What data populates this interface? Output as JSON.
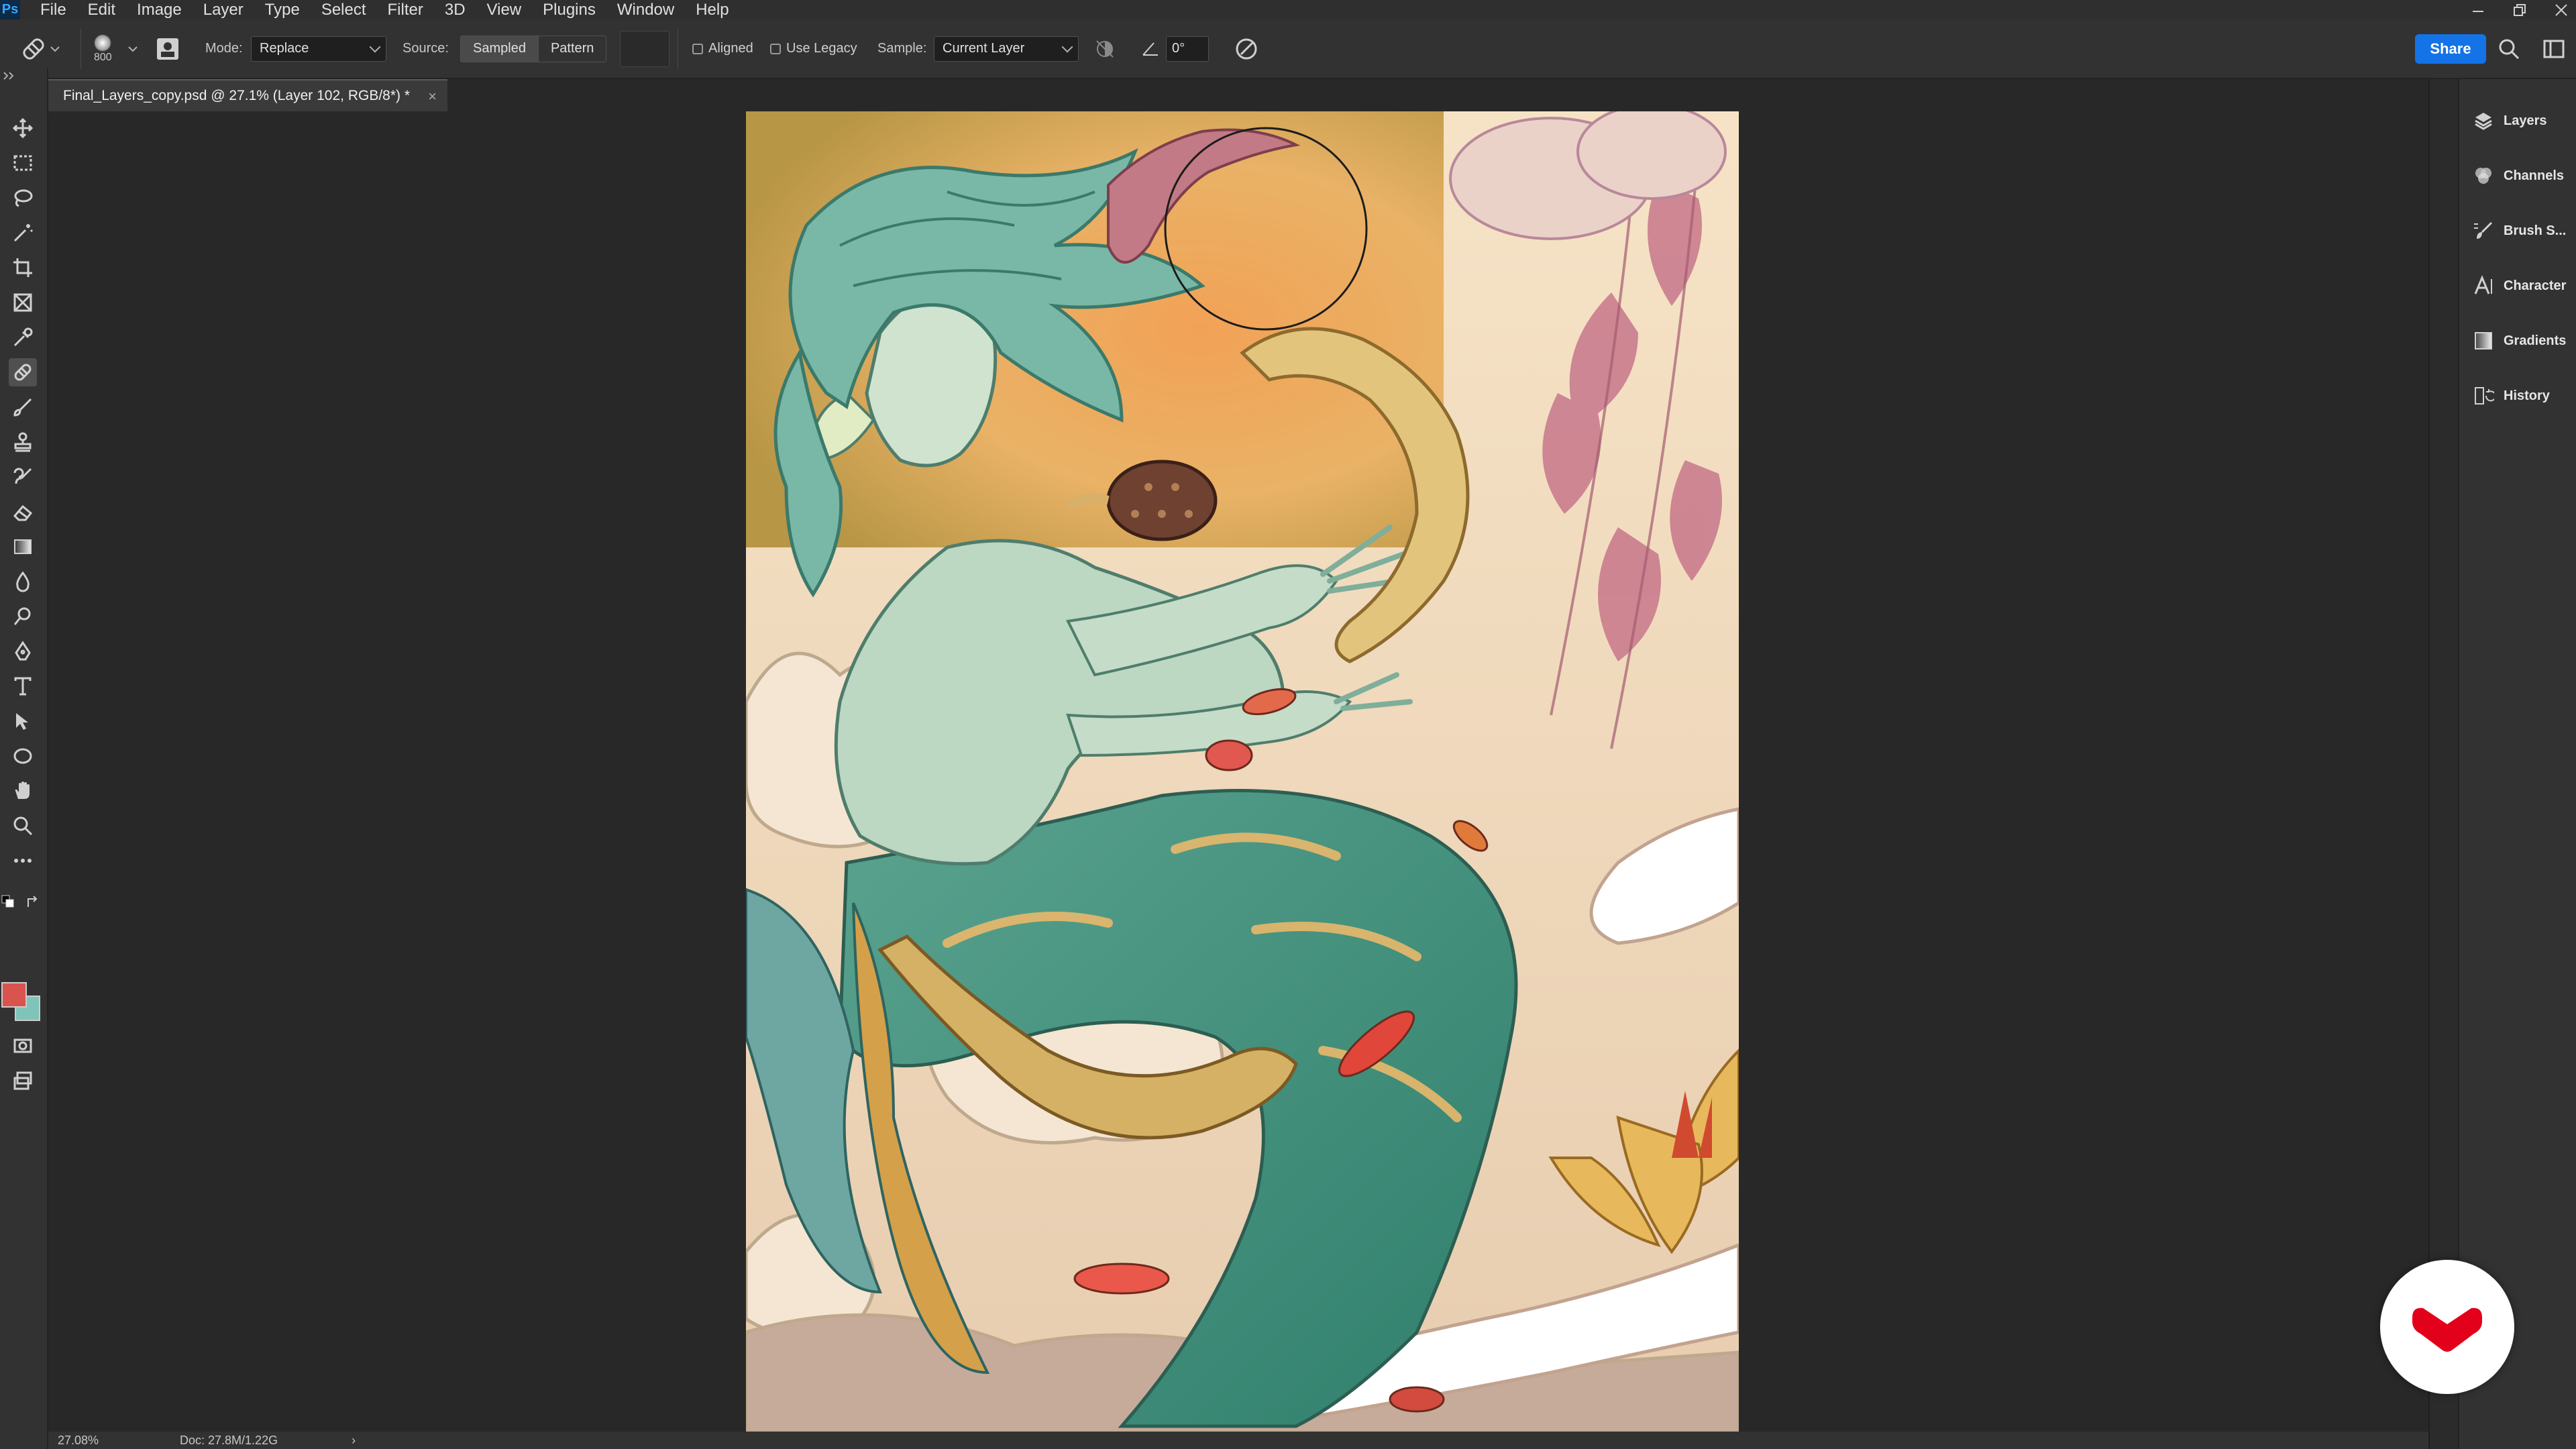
{
  "app": {
    "logo": "Ps"
  },
  "menu": [
    "File",
    "Edit",
    "Image",
    "Layer",
    "Type",
    "Select",
    "Filter",
    "3D",
    "View",
    "Plugins",
    "Window",
    "Help"
  ],
  "options_bar": {
    "brush_size": "800",
    "mode_label": "Mode:",
    "mode_value": "Replace",
    "source_label": "Source:",
    "source_options": [
      "Sampled",
      "Pattern"
    ],
    "aligned_label": "Aligned",
    "use_legacy_label": "Use Legacy",
    "sample_label": "Sample:",
    "sample_value": "Current Layer",
    "angle_value": "0°",
    "share_label": "Share"
  },
  "document": {
    "tab_title": "Final_Layers_copy.psd @ 27.1% (Layer 102, RGB/8*) *",
    "close_glyph": "×"
  },
  "right_panel": {
    "items": [
      {
        "label": "Layers",
        "icon": "layers-icon"
      },
      {
        "label": "Channels",
        "icon": "channels-icon"
      },
      {
        "label": "Brush S...",
        "icon": "brush-settings-icon"
      },
      {
        "label": "Character",
        "icon": "character-icon"
      },
      {
        "label": "Gradients",
        "icon": "gradients-icon"
      },
      {
        "label": "History",
        "icon": "history-icon"
      }
    ]
  },
  "statusbar": {
    "zoom": "27.08%",
    "doc_info": "Doc: 27.8M/1.22G",
    "arrow": "›"
  },
  "colors": {
    "foreground": "#d9534f",
    "background": "#7fc4b8",
    "accent": "#1473e6",
    "watermark": "#e3001b"
  }
}
